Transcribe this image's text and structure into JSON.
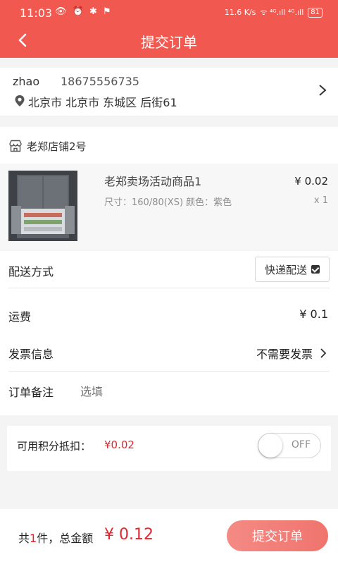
{
  "status": {
    "time": "11:03",
    "left_icons": "👁 ⏰ ✱ ⚑",
    "net_speed": "11.6 K/s",
    "signal": "ᯤ ⁴ᴳ.ıll ⁴ᴳ.ıll",
    "battery": "81"
  },
  "header": {
    "title": "提交订单"
  },
  "address": {
    "name": "zhao",
    "phone": "18675556735",
    "text": "北京市 北京市 东城区 后街61"
  },
  "store": {
    "name": "老郑店铺2号"
  },
  "product": {
    "title": "老郑卖场活动商品1",
    "spec": "尺寸：160/80(XS)  颜色：紫色",
    "price": "¥ 0.02",
    "qty": "x 1"
  },
  "delivery": {
    "label": "配送方式",
    "value": "快递配送"
  },
  "freight": {
    "label": "运费",
    "value": "¥ 0.1"
  },
  "invoice": {
    "label": "发票信息",
    "value": "不需要发票"
  },
  "remark": {
    "label": "订单备注",
    "placeholder": "选填"
  },
  "points": {
    "label": "可用积分抵扣：",
    "value": "¥0.02",
    "toggle": "OFF"
  },
  "footer": {
    "prefix": "共",
    "count": "1",
    "suffix": "件，总金额",
    "amount": "¥ 0.12",
    "submit": "提交订单"
  },
  "colors": {
    "primary": "#f1584f",
    "accent_red": "#e3262e"
  }
}
